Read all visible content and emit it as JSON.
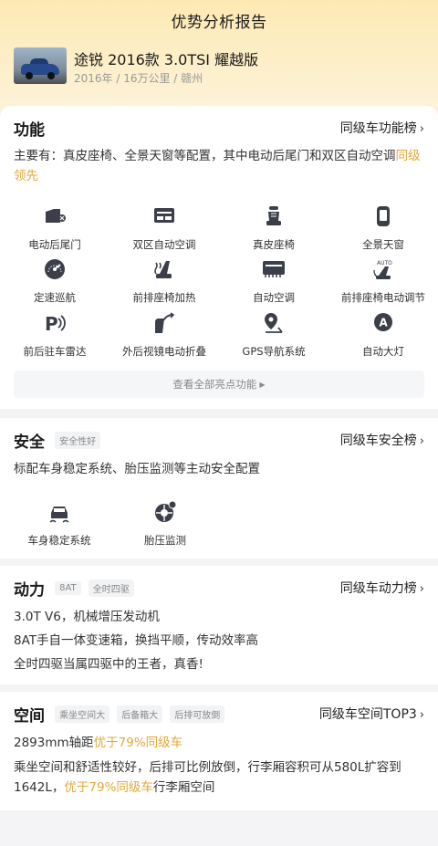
{
  "header": {
    "title": "优势分析报告"
  },
  "car": {
    "name": "途锐 2016款 3.0TSI 耀越版",
    "meta": "2016年 / 16万公里 / 赣州"
  },
  "functions": {
    "title": "功能",
    "rank_label": "同级车功能榜",
    "desc_main": "主要有：真皮座椅、全景天窗等配置，其中电动后尾门和双区自动空调",
    "desc_highlight": "同级领先",
    "items": [
      {
        "label": "电动后尾门",
        "icon": "power-tailgate-icon"
      },
      {
        "label": "双区自动空调",
        "icon": "dual-zone-ac-icon"
      },
      {
        "label": "真皮座椅",
        "icon": "leather-seat-icon"
      },
      {
        "label": "全景天窗",
        "icon": "panoramic-sunroof-icon"
      },
      {
        "label": "定速巡航",
        "icon": "cruise-control-icon"
      },
      {
        "label": "前排座椅加热",
        "icon": "seat-heating-icon"
      },
      {
        "label": "自动空调",
        "icon": "auto-ac-icon"
      },
      {
        "label": "前排座椅电动调节",
        "icon": "power-seat-adjust-icon"
      },
      {
        "label": "前后驻车雷达",
        "icon": "parking-radar-icon"
      },
      {
        "label": "外后视镜电动折叠",
        "icon": "mirror-fold-icon"
      },
      {
        "label": "GPS导航系统",
        "icon": "gps-navigation-icon"
      },
      {
        "label": "自动大灯",
        "icon": "auto-headlight-icon"
      }
    ],
    "more_label": "查看全部亮点功能"
  },
  "safety": {
    "title": "安全",
    "tags": [
      "安全性好"
    ],
    "rank_label": "同级车安全榜",
    "desc": "标配车身稳定系统、胎压监测等主动安全配置",
    "items": [
      {
        "label": "车身稳定系统",
        "icon": "stability-control-icon"
      },
      {
        "label": "胎压监测",
        "icon": "tire-pressure-icon"
      }
    ]
  },
  "power": {
    "title": "动力",
    "tags": [
      "8AT",
      "全时四驱"
    ],
    "rank_label": "同级车动力榜",
    "lines": [
      "3.0T V6，机械增压发动机",
      "8AT手自一体变速箱，换挡平顺，传动效率高",
      "全时四驱当属四驱中的王者，真香!"
    ]
  },
  "space": {
    "title": "空间",
    "tags": [
      "乘坐空间大",
      "后备箱大",
      "后排可放倒"
    ],
    "rank_label": "同级车空间TOP3",
    "line1_main": "2893mm轴距",
    "line1_hl": "优于79%同级车",
    "line2_main": "乘坐空间和舒适性较好，后排可比例放倒，行李厢容积可从580L扩容到1642L，",
    "line2_hl": "优于79%同级车",
    "line2_tail": "行李厢空间"
  },
  "colors": {
    "accent": "#e0a83a",
    "icon": "#3a3f4a",
    "hero": "#fde9b3"
  }
}
